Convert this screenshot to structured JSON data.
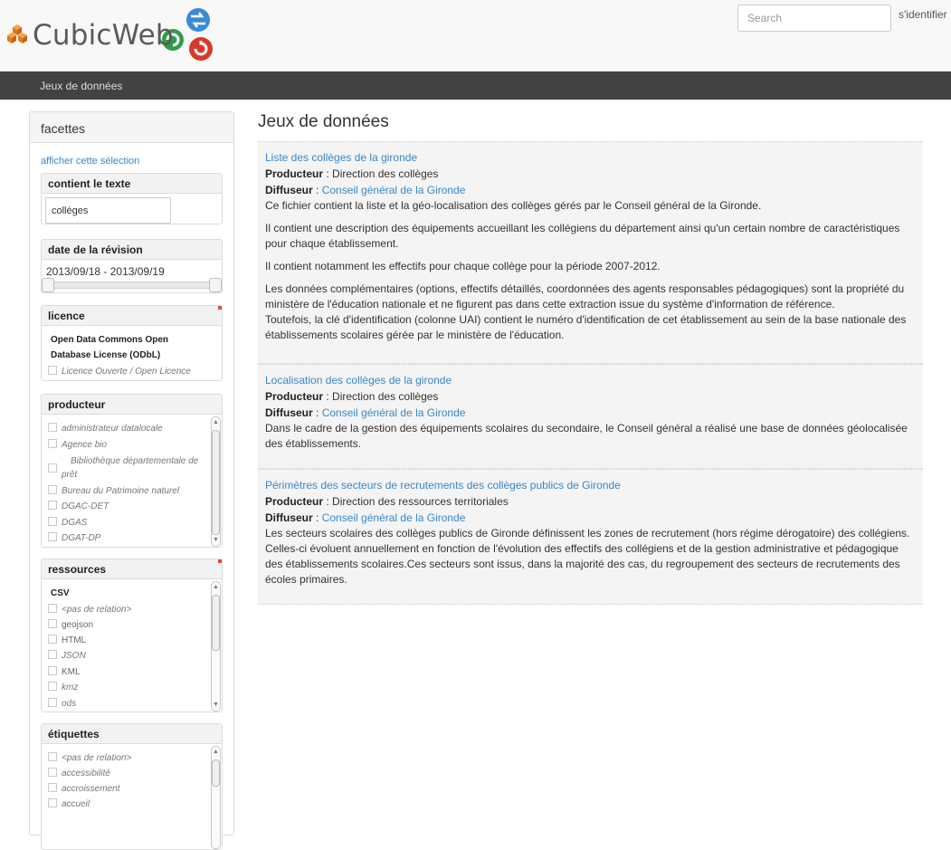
{
  "header": {
    "brand": "CubicWeb",
    "search_placeholder": "Search",
    "login_label": "s'identifier"
  },
  "navbar": {
    "item": "Jeux de données"
  },
  "facets": {
    "title": "facettes",
    "show_selection": "afficher cette sélection",
    "contains_text": {
      "title": "contient le texte",
      "value": "collèges"
    },
    "revision_date": {
      "title": "date de la révision",
      "range": "2013/09/18 - 2013/09/19"
    },
    "licence": {
      "title": "licence",
      "selected": "Open Data Commons Open Database License (ODbL)",
      "options": [
        "Licence Ouverte / Open Licence"
      ]
    },
    "producer": {
      "title": "producteur",
      "options": [
        "administrateur datalocale",
        "Agence bio",
        "Bibliothèque départementale de prêt",
        "Bureau du Patrimoine naturel",
        "DGAC-DET",
        "DGAS",
        "DGAT-DP"
      ]
    },
    "resources": {
      "title": "ressources",
      "selected": "CSV",
      "options": [
        "<pas de relation>",
        "geojson",
        "HTML",
        "JSON",
        "KML",
        "kmz",
        "ods"
      ]
    },
    "tags": {
      "title": "étiquettes",
      "options": [
        "<pas de relation>",
        "accessibilité",
        "accroissement",
        "accueil"
      ]
    }
  },
  "main": {
    "title": "Jeux de données",
    "producer_label": "Producteur",
    "distributor_label": "Diffuseur",
    "datasets": [
      {
        "title": "Liste des collèges de la gironde",
        "producer": "Direction des collèges",
        "distributor": "Conseil général de la Gironde",
        "description": "Ce fichier contient la liste et la géo-localisation des collèges gérés par le Conseil général de la Gironde.",
        "paragraphs": [
          "Il contient une description des équipements accueillant les collégiens du département ainsi qu'un certain nombre de caractéristiques pour chaque établissement.",
          "Il contient notamment les effectifs pour chaque collège pour la période 2007-2012.",
          "Les données complémentaires (options, effectifs détaillés, coordonnées des agents responsables pédagogiques) sont la propriété du ministère de l'éducation nationale et ne figurent pas dans cette extraction issue du système d'information de référence.",
          "Toutefois, la clé d'identification (colonne UAI) contient le numéro d'identification de cet établissement au sein de la base nationale des établissements scolaires gérée par le ministère de l'éducation."
        ]
      },
      {
        "title": "Localisation des collèges de la gironde",
        "producer": "Direction des collèges",
        "distributor": "Conseil général de la Gironde",
        "description": "Dans le cadre de la gestion des équipements scolaires du secondaire, le Conseil général a réalisé une base de données géolocalisée des établissements."
      },
      {
        "title": "Périmètres des secteurs de recrutements des collèges publics de Gironde",
        "producer": "Direction des ressources territoriales",
        "distributor": "Conseil général de la Gironde",
        "description": "Les secteurs scolaires des collèges publics de Gironde définissent les zones de recrutement (hors régime dérogatoire) des collégiens. Celles-ci évoluent annuellement en fonction de l'évolution des effectifs des collégiens et de la gestion administrative et pédagogique des établissements scolaires.Ces secteurs sont issus, dans la majorité des cas, du regroupement des secteurs de recrutements des écoles primaires."
      }
    ]
  }
}
